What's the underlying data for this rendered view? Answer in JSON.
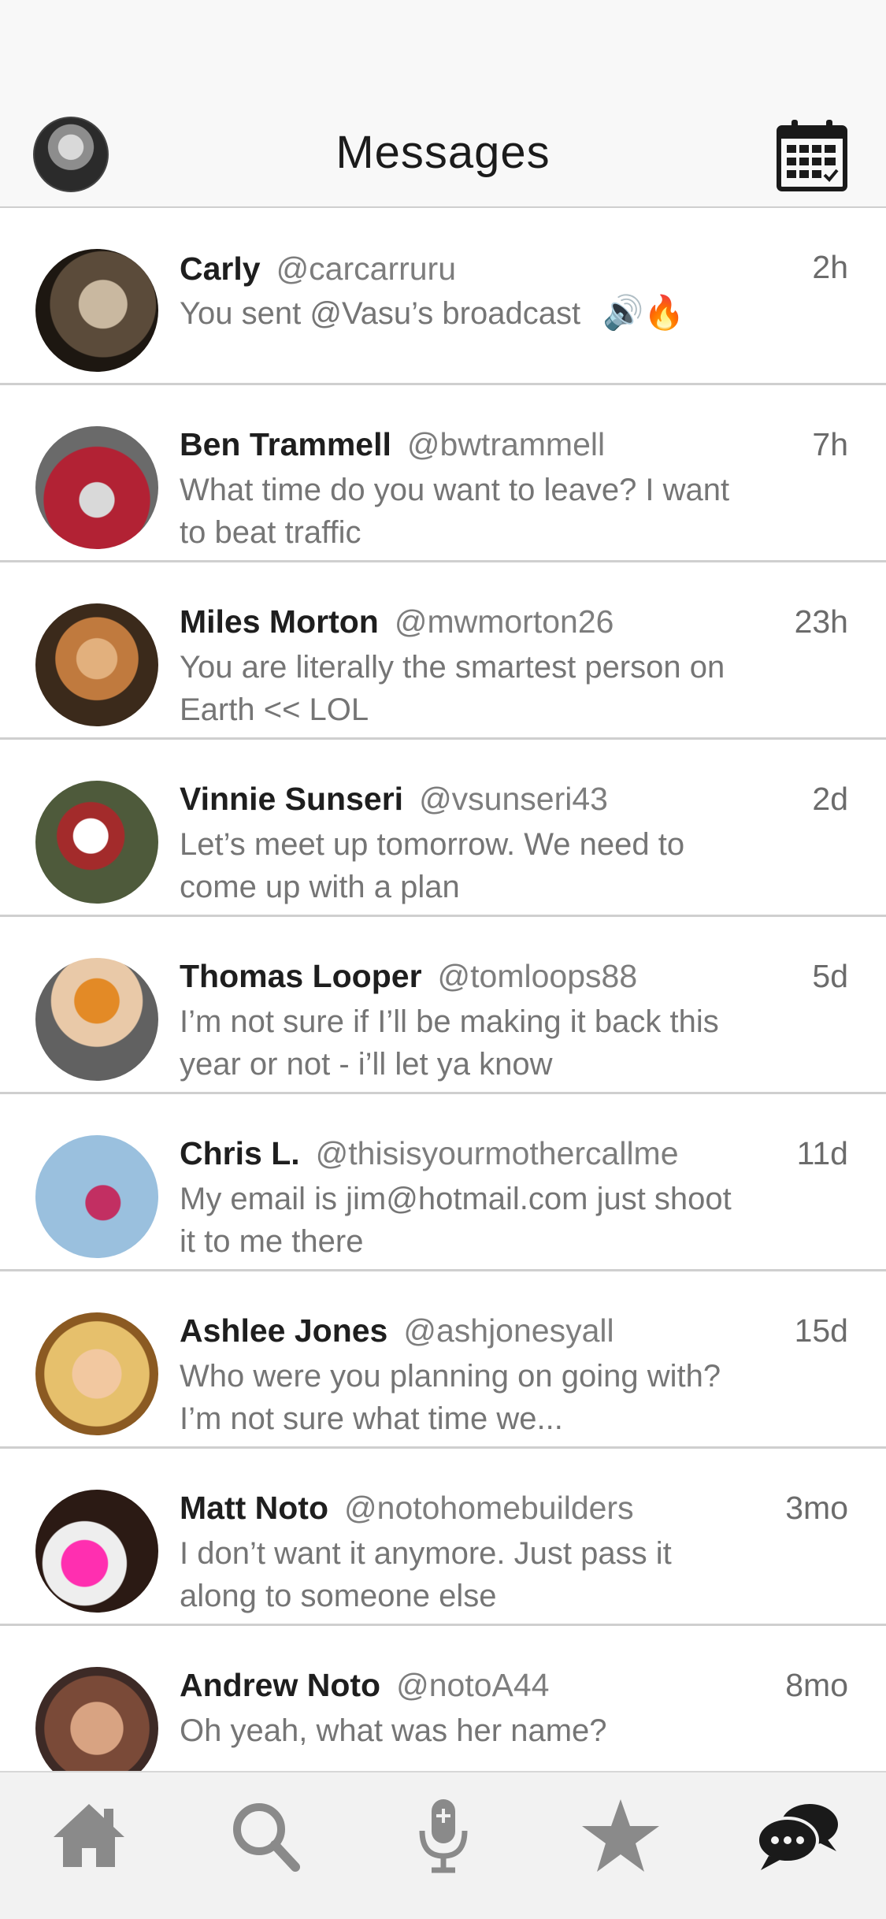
{
  "header": {
    "title": "Messages"
  },
  "colors": {
    "icon_gray": "#8a8a8a",
    "icon_dark": "#1a1a1a",
    "divider": "#cfcfcf"
  },
  "messages": [
    {
      "name": "Carly",
      "handle": "@carcarruru",
      "time": "2h",
      "text": "You sent @Vasu’s broadcast",
      "emoji": "🔊🔥"
    },
    {
      "name": "Ben Trammell",
      "handle": "@bwtrammell",
      "time": "7h",
      "text": "What time do you want to leave?  I want to beat traffic"
    },
    {
      "name": "Miles Morton",
      "handle": "@mwmorton26",
      "time": "23h",
      "text": "You are literally the smartest person on Earth << LOL"
    },
    {
      "name": "Vinnie Sunseri",
      "handle": "@vsunseri43",
      "time": "2d",
      "text": "Let’s meet up tomorrow.  We need to come up with a plan"
    },
    {
      "name": "Thomas Looper",
      "handle": "@tomloops88",
      "time": "5d",
      "text": "I’m not sure if I’ll be making it back this year or not - i’ll let ya know"
    },
    {
      "name": "Chris L.",
      "handle": "@thisisyourmothercallme",
      "time": "11d",
      "text": "My email is jim@hotmail.com just shoot it to me there"
    },
    {
      "name": "Ashlee Jones",
      "handle": "@ashjonesyall",
      "time": "15d",
      "text": "Who were you planning on going with?  I’m not sure what time we..."
    },
    {
      "name": "Matt Noto",
      "handle": "@notohomebuilders",
      "time": "3mo",
      "text": "I don’t want it anymore.  Just pass it along to someone else"
    },
    {
      "name": "Andrew Noto",
      "handle": "@notoA44",
      "time": "8mo",
      "text": "Oh yeah, what was her name?"
    }
  ],
  "tabs": [
    {
      "icon": "home-icon"
    },
    {
      "icon": "search-icon"
    },
    {
      "icon": "microphone-icon"
    },
    {
      "icon": "star-icon"
    },
    {
      "icon": "chat-bubbles-icon"
    }
  ]
}
